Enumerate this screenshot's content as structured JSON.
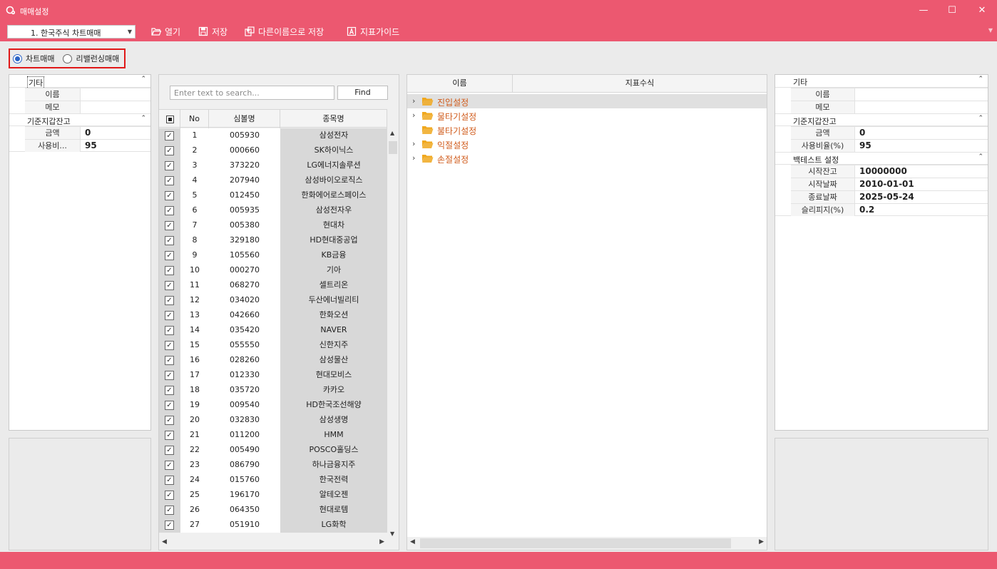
{
  "window": {
    "title": "매매설정",
    "minimize": "—",
    "maximize": "☐",
    "close": "✕",
    "icon": "gear-refresh-icon"
  },
  "toolbar": {
    "strategy_combo": "1. 한국주식 차트매매",
    "open": "열기",
    "save": "저장",
    "save_as": "다른이름으로 저장",
    "indicator_guide": "지표가이드"
  },
  "mode": {
    "options": [
      "차트매매",
      "리밸런싱매매"
    ],
    "selected": "차트매매"
  },
  "left_props": {
    "cat_etc": "기타",
    "name_key": "이름",
    "name_val": "",
    "memo_key": "메모",
    "memo_val": "",
    "cat_balance": "기준지갑잔고",
    "amount_key": "금액",
    "amount_val": "0",
    "ratio_key": "사용비...",
    "ratio_val": "95"
  },
  "stock_list": {
    "search_placeholder": "Enter text to search...",
    "find_label": "Find",
    "columns": [
      "No",
      "심볼명",
      "종목명"
    ],
    "rows": [
      {
        "no": "1",
        "code": "005930",
        "name": "삼성전자"
      },
      {
        "no": "2",
        "code": "000660",
        "name": "SK하이닉스"
      },
      {
        "no": "3",
        "code": "373220",
        "name": "LG에너지솔루션"
      },
      {
        "no": "4",
        "code": "207940",
        "name": "삼성바이오로직스"
      },
      {
        "no": "5",
        "code": "012450",
        "name": "한화에어로스페이스"
      },
      {
        "no": "6",
        "code": "005935",
        "name": "삼성전자우"
      },
      {
        "no": "7",
        "code": "005380",
        "name": "현대차"
      },
      {
        "no": "8",
        "code": "329180",
        "name": "HD현대중공업"
      },
      {
        "no": "9",
        "code": "105560",
        "name": "KB금융"
      },
      {
        "no": "10",
        "code": "000270",
        "name": "기아"
      },
      {
        "no": "11",
        "code": "068270",
        "name": "셀트리온"
      },
      {
        "no": "12",
        "code": "034020",
        "name": "두산에너빌리티"
      },
      {
        "no": "13",
        "code": "042660",
        "name": "한화오션"
      },
      {
        "no": "14",
        "code": "035420",
        "name": "NAVER"
      },
      {
        "no": "15",
        "code": "055550",
        "name": "신한지주"
      },
      {
        "no": "16",
        "code": "028260",
        "name": "삼성물산"
      },
      {
        "no": "17",
        "code": "012330",
        "name": "현대모비스"
      },
      {
        "no": "18",
        "code": "035720",
        "name": "카카오"
      },
      {
        "no": "19",
        "code": "009540",
        "name": "HD한국조선해양"
      },
      {
        "no": "20",
        "code": "032830",
        "name": "삼성생명"
      },
      {
        "no": "21",
        "code": "011200",
        "name": "HMM"
      },
      {
        "no": "22",
        "code": "005490",
        "name": "POSCO홀딩스"
      },
      {
        "no": "23",
        "code": "086790",
        "name": "하나금융지주"
      },
      {
        "no": "24",
        "code": "015760",
        "name": "한국전력"
      },
      {
        "no": "25",
        "code": "196170",
        "name": "알테오젠"
      },
      {
        "no": "26",
        "code": "064350",
        "name": "현대로템"
      },
      {
        "no": "27",
        "code": "051910",
        "name": "LG화학"
      }
    ]
  },
  "indicator_tree": {
    "col_name": "이름",
    "col_formula": "지표수식",
    "nodes": [
      {
        "label": "진입설정",
        "expandable": true
      },
      {
        "label": "물타기설정",
        "expandable": true
      },
      {
        "label": "불타기설정",
        "expandable": false
      },
      {
        "label": "익절설정",
        "expandable": true
      },
      {
        "label": "손절설정",
        "expandable": true
      }
    ]
  },
  "right_props": {
    "cat_etc": "기타",
    "name_key": "이름",
    "name_val": "",
    "memo_key": "메모",
    "memo_val": "",
    "cat_balance": "기준지갑잔고",
    "amount_key": "금액",
    "amount_val": "0",
    "ratio_key": "사용비율(%)",
    "ratio_val": "95",
    "cat_backtest": "백테스트 설정",
    "start_bal_key": "시작잔고",
    "start_bal_val": "10000000",
    "start_date_key": "시작날짜",
    "start_date_val": "2010-01-01",
    "end_date_key": "종료날짜",
    "end_date_val": "2025-05-24",
    "slippage_key": "슬리피지(%)",
    "slippage_val": "0.2"
  },
  "colors": {
    "accent": "#ec5870",
    "radio_selected": "#2a64c6",
    "folder": "#f0a81e",
    "tree_label": "#d05a1a",
    "highlight_box": "#e01818"
  }
}
